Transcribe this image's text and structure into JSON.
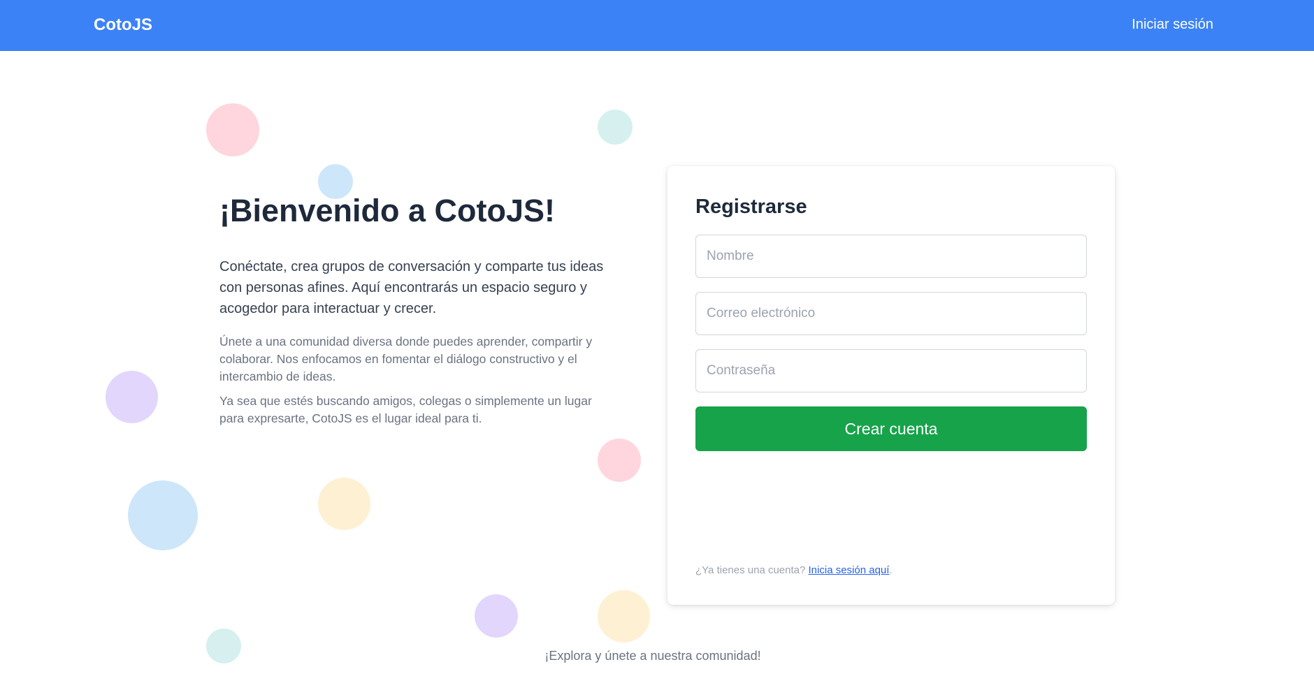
{
  "navbar": {
    "brand": "CotoJS",
    "login_link": "Iniciar sesión",
    "color": "#3b82f6"
  },
  "hero": {
    "title": "¡Bienvenido a CotoJS!",
    "lead": "Conéctate, crea grupos de conversación y comparte tus ideas con personas afines. Aquí encontrarás un espacio seguro y acogedor para interactuar y crecer.",
    "paragraph_1": "Únete a una comunidad diversa donde puedes aprender, compartir y colaborar. Nos enfocamos en fomentar el diálogo constructivo y el intercambio de ideas.",
    "paragraph_2": "Ya sea que estés buscando amigos, colegas o simplemente un lugar para expresarte, CotoJS es el lugar ideal para ti."
  },
  "signup": {
    "title": "Registrarse",
    "name_placeholder": "Nombre",
    "email_placeholder": "Correo electrónico",
    "password_placeholder": "Contraseña",
    "submit_label": "Crear cuenta",
    "footer_text": "¿Ya tienes una cuenta?",
    "footer_link": "Inicia sesión aquí",
    "footer_suffix": ".",
    "button_color": "#16a34a"
  },
  "bottom_text": "¡Explora y únete a nuestra comunidad!",
  "bubble_colors": [
    "#fbcfe8",
    "#ccfbf1",
    "#bfdbfe",
    "#ddd6fe",
    "#fef3c7"
  ]
}
